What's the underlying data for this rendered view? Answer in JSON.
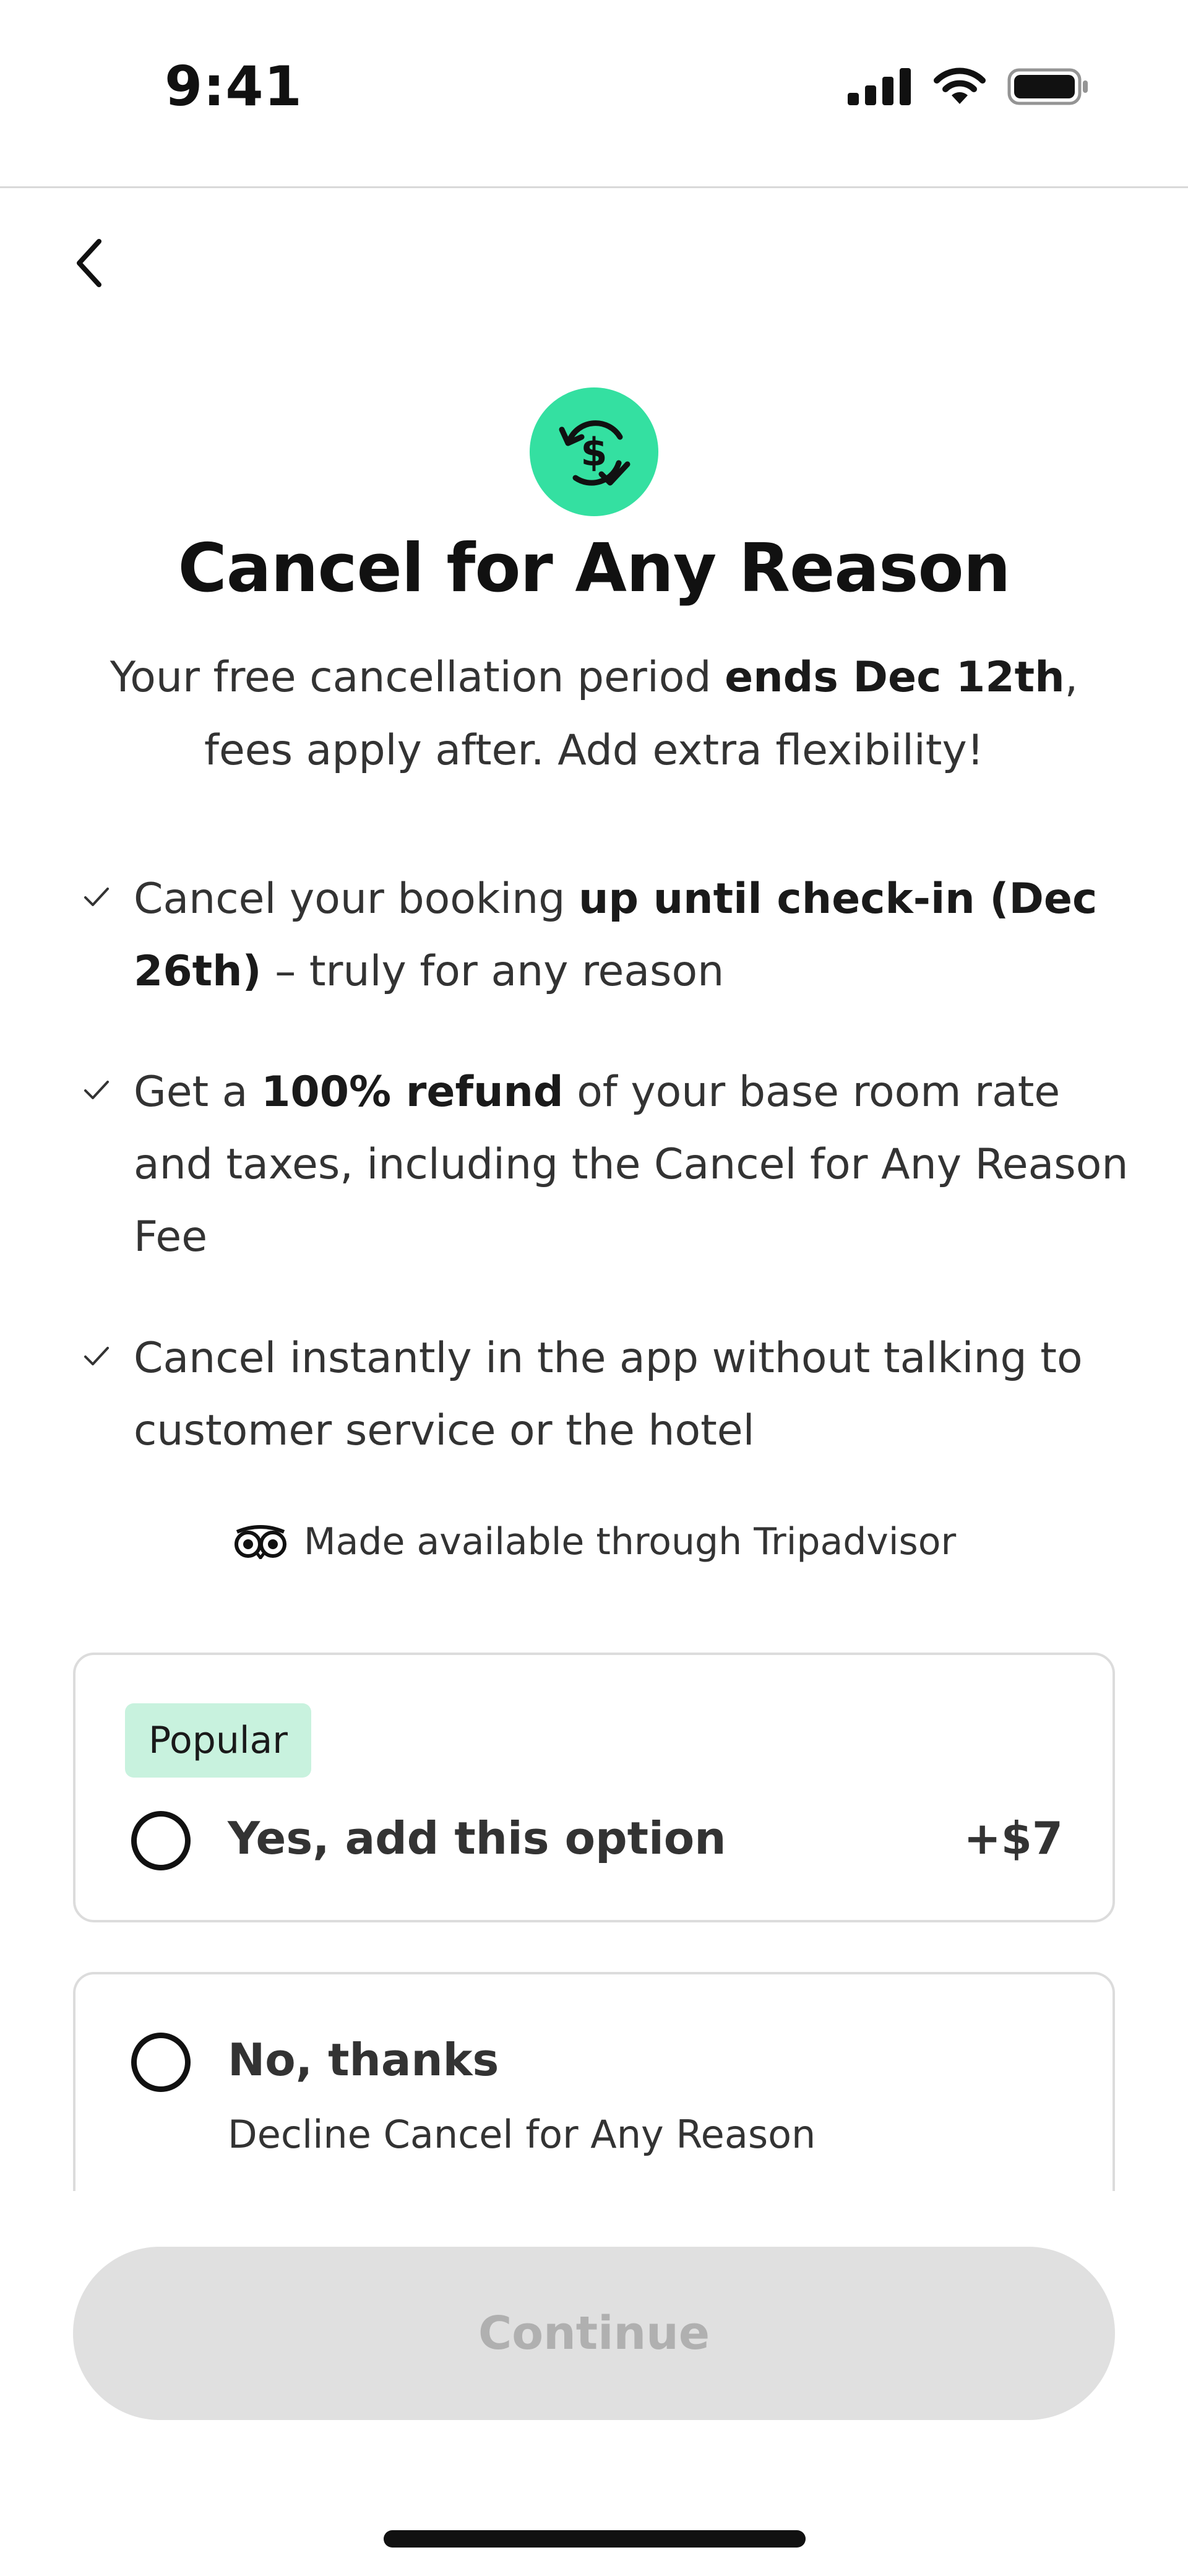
{
  "status_bar": {
    "time": "9:41",
    "icons": [
      "signal-icon",
      "wifi-icon",
      "battery-icon"
    ]
  },
  "header": {
    "back_icon": "chevron-left-icon"
  },
  "hero": {
    "icon": "refresh-dollar-icon",
    "icon_color": "#34e0a1",
    "title": "Cancel for Any Reason",
    "subtitle_part1": "Your free cancellation period ",
    "subtitle_bold": "ends Dec 12th",
    "subtitle_part2": ", fees apply after. Add extra flexibility!"
  },
  "benefits": [
    {
      "icon": "check-icon",
      "pre": "Cancel your booking ",
      "bold": "up until check-in (Dec 26th)",
      "post": " – truly for any reason"
    },
    {
      "icon": "check-icon",
      "pre": "Get a ",
      "bold": "100% refund",
      "post": " of your base room rate and taxes, including the Cancel for Any Reason Fee"
    },
    {
      "icon": "check-icon",
      "pre": "Cancel instantly in the app without talking to customer service or the hotel",
      "bold": "",
      "post": ""
    }
  ],
  "provider": {
    "icon": "tripadvisor-owl-icon",
    "text": "Made available through Tripadvisor"
  },
  "options": {
    "yes": {
      "badge": "Popular",
      "badge_color": "#c8f2de",
      "label": "Yes, add this option",
      "price": "+$7",
      "selected": false
    },
    "no": {
      "label": "No, thanks",
      "sublabel": "Decline Cancel for Any Reason",
      "selected": false
    }
  },
  "footer": {
    "continue_label": "Continue",
    "continue_enabled": false
  }
}
